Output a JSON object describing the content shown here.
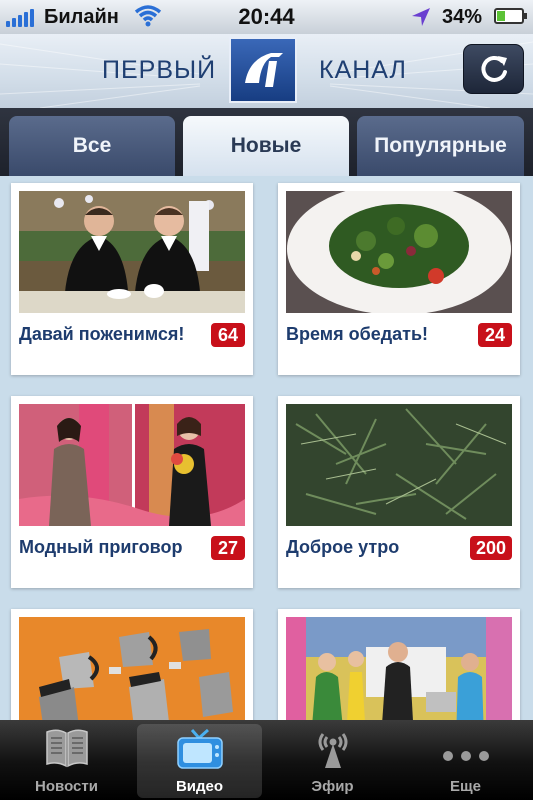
{
  "status_bar": {
    "carrier": "Билайн",
    "time": "20:44",
    "battery": "34%",
    "battery_level": 0.34
  },
  "header": {
    "title_left": "ПЕРВЫЙ",
    "title_right": "КАНАЛ",
    "logo_icon": "channel-one-logo",
    "refresh_icon": "refresh-icon"
  },
  "segments": [
    {
      "label": "Все",
      "selected": false
    },
    {
      "label": "Новые",
      "selected": true
    },
    {
      "label": "Популярные",
      "selected": false
    }
  ],
  "cards": [
    {
      "title": "Давай поженимся!",
      "count": "64"
    },
    {
      "title": "Время обедать!",
      "count": "24"
    },
    {
      "title": "Модный приговор",
      "count": "27"
    },
    {
      "title": "Доброе утро",
      "count": "200"
    },
    {
      "title": "",
      "count": ""
    },
    {
      "title": "",
      "count": ""
    }
  ],
  "tabbar": [
    {
      "label": "Новости",
      "icon": "book-icon",
      "selected": false
    },
    {
      "label": "Видео",
      "icon": "tv-icon",
      "selected": true
    },
    {
      "label": "Эфир",
      "icon": "antenna-icon",
      "selected": false
    },
    {
      "label": "Еще",
      "icon": "more-icon",
      "selected": false
    }
  ],
  "colors": {
    "badge": "#c8101a",
    "title_text": "#1e3c6e",
    "background": "#c9dcea"
  }
}
